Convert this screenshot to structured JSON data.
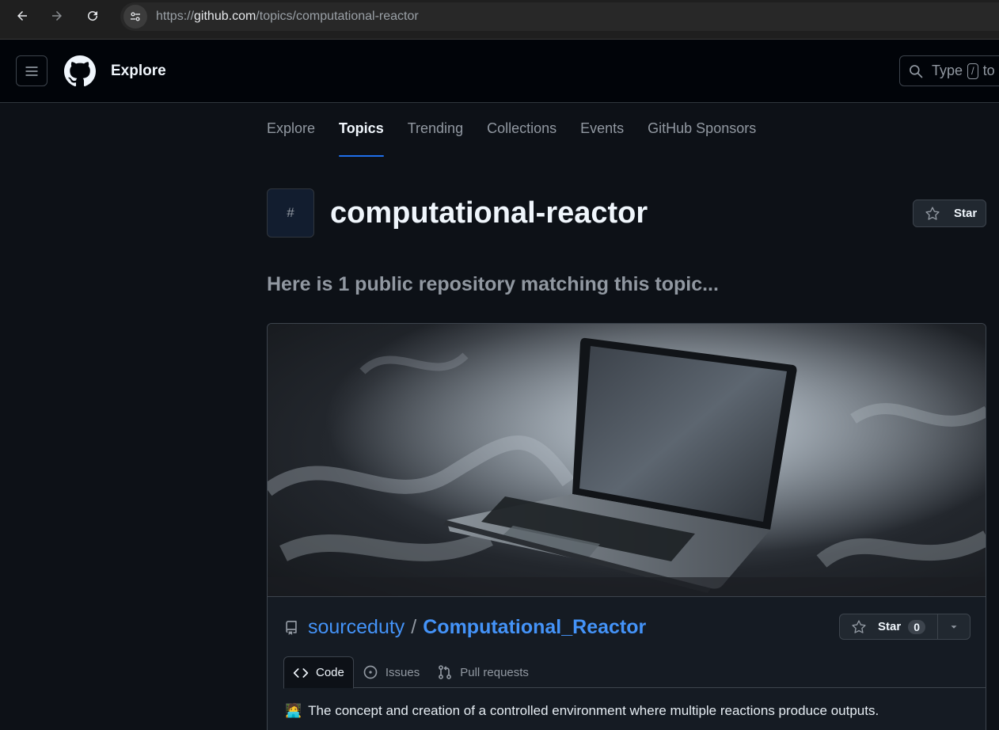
{
  "browser": {
    "url_host": "github.com",
    "url_scheme": "https://",
    "url_path": "/topics/computational-reactor",
    "icons": [
      "back-arrow-icon",
      "forward-arrow-icon",
      "reload-icon",
      "site-info-icon"
    ]
  },
  "header": {
    "title": "Explore",
    "search_prefix": "Type",
    "search_key": "/",
    "search_suffix": "to s"
  },
  "subnav": {
    "tabs": [
      "Explore",
      "Topics",
      "Trending",
      "Collections",
      "Events",
      "GitHub Sponsors"
    ],
    "active": "Topics"
  },
  "topic": {
    "badge": "#",
    "title": "computational-reactor",
    "star_label": "Star",
    "match_text": "Here is 1 public repository matching this topic..."
  },
  "repo": {
    "owner": "sourceduty",
    "separator": "/",
    "name": "Computational_Reactor",
    "star_label": "Star",
    "star_count": "0",
    "tabs": [
      "Code",
      "Issues",
      "Pull requests"
    ],
    "active_tab": "Code",
    "description_emoji": "🧑‍💻",
    "description": "The concept and creation of a controlled environment where multiple reactions produce outputs."
  },
  "colors": {
    "accent_blue": "#4493f8",
    "tab_underline": "#1f6feb",
    "background": "#0d1117"
  }
}
